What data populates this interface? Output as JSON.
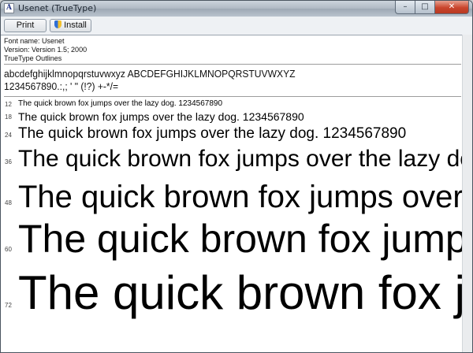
{
  "window": {
    "title": "Usenet (TrueType)",
    "minimize_glyph": "–",
    "maximize_glyph": "□",
    "close_glyph": "✕"
  },
  "toolbar": {
    "print_label": "Print",
    "install_label": "Install"
  },
  "font_info": {
    "name_line": "Font name: Usenet",
    "version_line": "Version: Version 1.5; 2000",
    "type_line": "TrueType Outlines"
  },
  "charset": {
    "line1": "abcdefghijklmnopqrstuvwxyz ABCDEFGHIJKLMNOPQRSTUVWXYZ",
    "line2": "1234567890.:,; ' \" (!?) +-*/="
  },
  "samples": [
    {
      "size": "12",
      "text": "The quick brown fox jumps over the lazy dog. 1234567890"
    },
    {
      "size": "18",
      "text": "The quick brown fox jumps over the lazy dog. 1234567890"
    },
    {
      "size": "24",
      "text": "The quick brown fox jumps over the lazy dog. 1234567890"
    },
    {
      "size": "36",
      "text": "The quick brown fox jumps over the lazy do"
    },
    {
      "size": "48",
      "text": "The quick brown fox jumps over"
    },
    {
      "size": "60",
      "text": "The quick brown fox jump"
    },
    {
      "size": "72",
      "text": "The quick brown fox j"
    }
  ],
  "icons": {
    "app": "font-file-icon",
    "install": "uac-shield-icon"
  }
}
